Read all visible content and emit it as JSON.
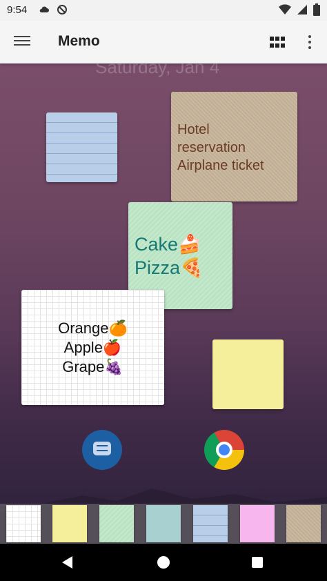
{
  "status_bar": {
    "time": "9:54",
    "icons_left": [
      "cloud-icon",
      "do-not-disturb-icon"
    ],
    "icons_right": [
      "wifi-icon",
      "cell-signal-icon",
      "battery-icon"
    ]
  },
  "app_bar": {
    "title": "Memo",
    "menu_icon": "hamburger-menu-icon",
    "layout_icon": "grid-view-icon",
    "more_icon": "more-vert-icon"
  },
  "home_screen": {
    "date": "Saturday, Jan 4",
    "notes": [
      {
        "id": "lined-blue",
        "style": "lined",
        "color": "#b9cfe9",
        "text": ""
      },
      {
        "id": "kraft",
        "style": "kraft",
        "color": "#c7b49a",
        "text": "Hotel\nreservation\nAirplane ticket"
      },
      {
        "id": "green",
        "style": "textured",
        "color": "#b9e3c2",
        "text": "Cake🍰\nPizza🍕"
      },
      {
        "id": "grid-white",
        "style": "grid",
        "color": "#ffffff",
        "text": "Orange🍊\nApple🍎\nGrape🍇"
      },
      {
        "id": "yellow",
        "style": "plain",
        "color": "#f5ee9b",
        "text": ""
      }
    ],
    "app_icons": [
      "messages-icon",
      "chrome-icon"
    ]
  },
  "note_tray": {
    "swatches": [
      {
        "name": "grid-white",
        "color": "#ffffff"
      },
      {
        "name": "yellow",
        "color": "#f5ee9b"
      },
      {
        "name": "green",
        "color": "#b9e3c2"
      },
      {
        "name": "teal",
        "color": "#a8d0d0"
      },
      {
        "name": "lined-blue",
        "color": "#b9cfe9"
      },
      {
        "name": "pink",
        "color": "#f8b6ee"
      },
      {
        "name": "kraft",
        "color": "#c7b49a"
      }
    ]
  },
  "nav_bar": {
    "icons": [
      "back-icon",
      "home-icon",
      "recents-icon"
    ]
  }
}
